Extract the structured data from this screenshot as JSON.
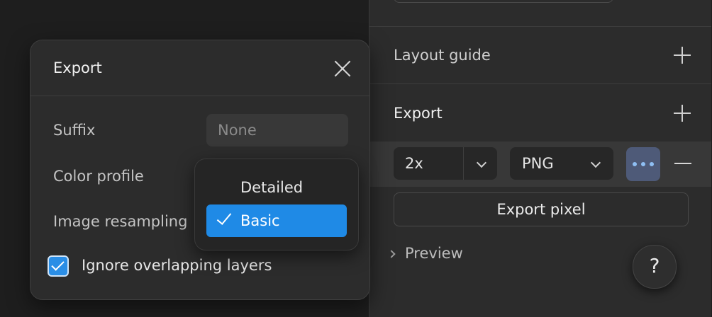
{
  "inspector": {
    "layout_guide": {
      "title": "Layout guide",
      "add_icon": "plus-icon"
    },
    "export": {
      "title": "Export",
      "add_icon": "plus-icon",
      "scale_value": "2x",
      "format_value": "PNG",
      "more_icon": "more-icon",
      "remove_icon": "minus-icon",
      "export_button_label": "Export pixel",
      "preview_label": "Preview"
    },
    "help_label": "?",
    "accent_color": "#1f8ae6"
  },
  "dialog": {
    "title": "Export",
    "close_icon": "close-icon",
    "suffix_label": "Suffix",
    "suffix_placeholder": "None",
    "color_profile_label": "Color profile",
    "resampling_label": "Image resampling",
    "checkbox_label": "Ignore overlapping layers",
    "checkbox_checked": true
  },
  "resampling_menu": {
    "options": [
      {
        "label": "Detailed",
        "selected": false
      },
      {
        "label": "Basic",
        "selected": true
      }
    ]
  }
}
